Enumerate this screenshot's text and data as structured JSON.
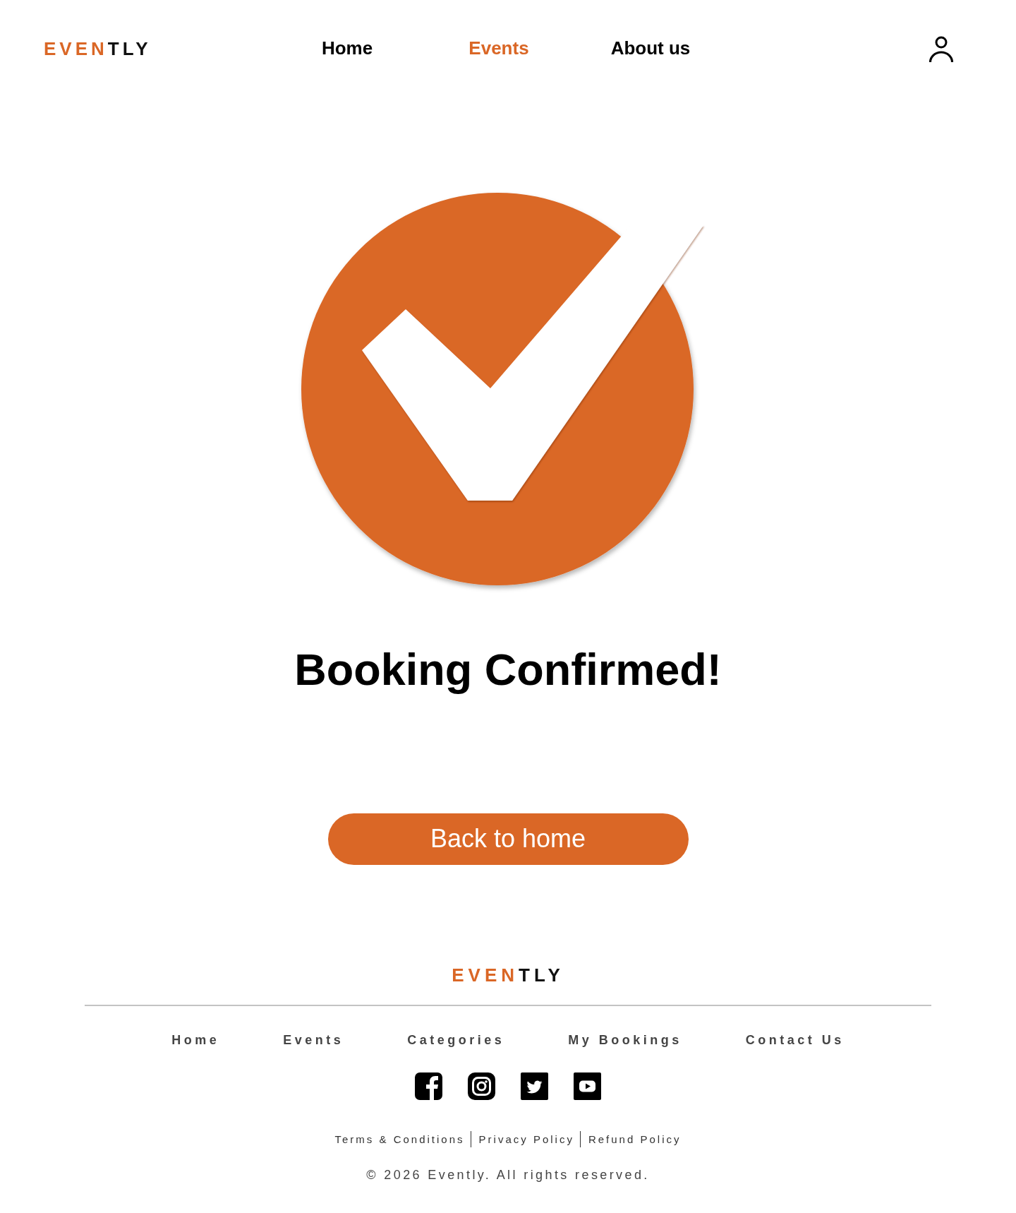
{
  "header": {
    "logo": {
      "highlight": "EVEN",
      "text": "TLY"
    },
    "nav": [
      {
        "label": "Home",
        "selected": false
      },
      {
        "label": "Events",
        "selected": true
      },
      {
        "label": "About us",
        "selected": false
      }
    ]
  },
  "confirmation": {
    "title": "Booking Confirmed!",
    "button": "Back to home"
  },
  "footer": {
    "logo": {
      "highlight": "EVEN",
      "text": "TLY"
    },
    "links": [
      "Home",
      "Events",
      "Categories",
      "My Bookings",
      "Contact Us"
    ],
    "legal": [
      "Terms & Conditions",
      "Privacy Policy",
      "Refund Policy"
    ],
    "copyright": "© 2026 Evently. All rights reserved."
  }
}
